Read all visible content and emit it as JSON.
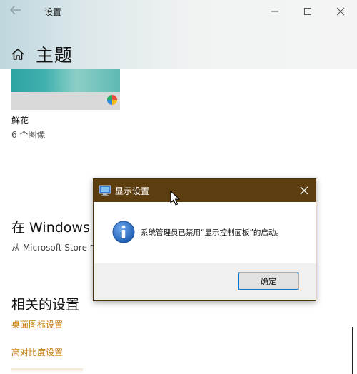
{
  "window": {
    "title": "设置",
    "back_icon": "back-arrow-icon",
    "controls": [
      "minimize-icon",
      "maximize-icon",
      "close-icon"
    ]
  },
  "header": {
    "icon": "home-icon",
    "title": "主题"
  },
  "theme_card": {
    "name": "鲜花",
    "count": "6 个图像"
  },
  "store_section": {
    "title": "在 Windows 中",
    "subtitle": "从 Microsoft Store 中"
  },
  "related": {
    "title": "相关的设置",
    "links": [
      "桌面图标设置",
      "高对比度设置"
    ]
  },
  "dialog": {
    "title": "显示设置",
    "icon": "display-settings-icon",
    "message_icon": "info-icon",
    "message": "系统管理员已禁用“显示控制面板”的启动。",
    "ok_label": "确定",
    "close_icon": "close-icon"
  },
  "colors": {
    "dialog_titlebar": "#5c3d10",
    "link": "#c47a08",
    "info_blue": "#1e5fb4"
  }
}
